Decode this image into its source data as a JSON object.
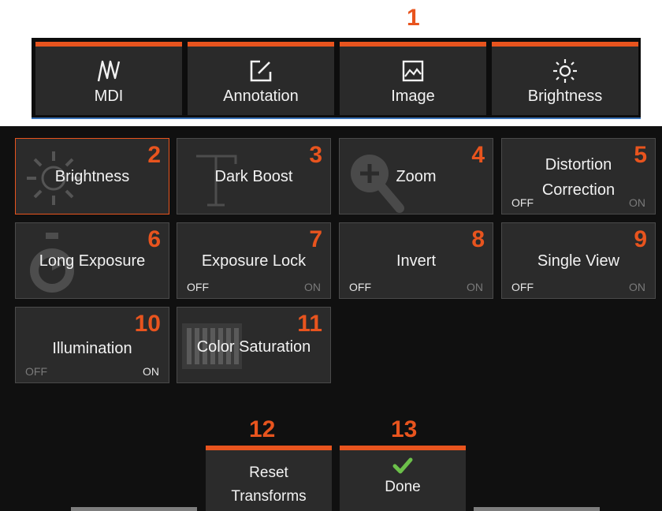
{
  "callouts": {
    "c1": "1",
    "c12": "12",
    "c13": "13"
  },
  "menu": {
    "tabs": [
      {
        "label": "MDI",
        "icon": "mdi-icon"
      },
      {
        "label": "Annotation",
        "icon": "annotation-icon"
      },
      {
        "label": "Image",
        "icon": "image-icon"
      },
      {
        "label": "Brightness",
        "icon": "brightness-icon"
      }
    ]
  },
  "tiles": [
    {
      "label": "Brightness",
      "num": "2",
      "icon": "sun-icon"
    },
    {
      "label": "Dark Boost",
      "num": "3",
      "icon": "dark-boost-icon"
    },
    {
      "label": "Zoom",
      "num": "4",
      "icon": "zoom-icon"
    },
    {
      "label_line1": "Distortion",
      "label_line2": "Correction",
      "num": "5",
      "off": "OFF",
      "on": "ON",
      "state": "off"
    },
    {
      "label": "Long Exposure",
      "num": "6",
      "icon": "stopwatch-icon"
    },
    {
      "label": "Exposure Lock",
      "num": "7",
      "off": "OFF",
      "on": "ON",
      "state": "off"
    },
    {
      "label": "Invert",
      "num": "8",
      "off": "OFF",
      "on": "ON",
      "state": "off"
    },
    {
      "label": "Single View",
      "num": "9",
      "off": "OFF",
      "on": "ON",
      "state": "off"
    },
    {
      "label": "Illumination",
      "num": "10",
      "off": "OFF",
      "on": "ON",
      "state": "on"
    },
    {
      "label": "Color Saturation",
      "num": "11",
      "icon": "color-bars-icon"
    }
  ],
  "buttons": {
    "reset": {
      "line1": "Reset",
      "line2": "Transforms"
    },
    "done": {
      "label": "Done",
      "icon": "checkmark-icon"
    }
  },
  "colors": {
    "accent": "#e8541e",
    "check": "#6cc04a",
    "tab_underline": "#3a73b8"
  }
}
